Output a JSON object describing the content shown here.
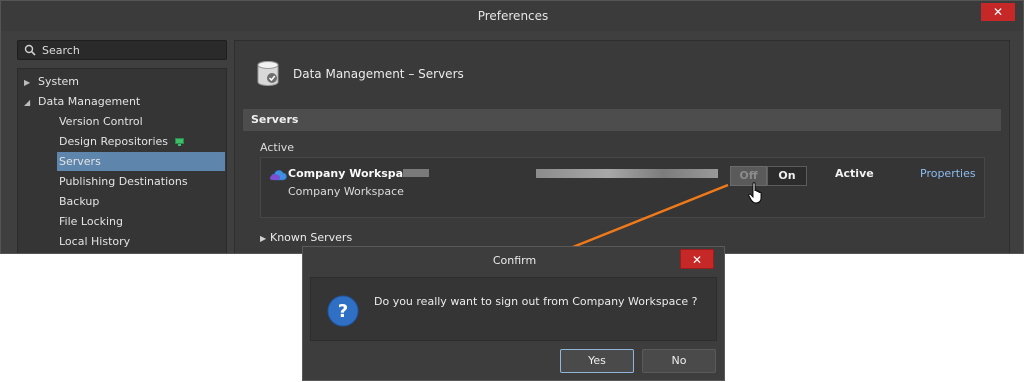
{
  "window": {
    "title": "Preferences",
    "close_glyph": "✕",
    "accent_close": "#c62828"
  },
  "search": {
    "placeholder": "Search",
    "icon": "search-icon"
  },
  "tree": {
    "items": [
      {
        "label": "System",
        "expand": "collapsed"
      },
      {
        "label": "Data Management",
        "expand": "expanded"
      },
      {
        "label": "Version Control"
      },
      {
        "label": "Design Repositories"
      },
      {
        "label": "Servers",
        "selected": true
      },
      {
        "label": "Publishing Destinations"
      },
      {
        "label": "Backup"
      },
      {
        "label": "File Locking"
      },
      {
        "label": "Local History"
      }
    ],
    "expanded_glyph": "◢",
    "collapsed_glyph": "▶",
    "selected_color": "#5e86ad"
  },
  "page": {
    "title": "Data Management – Servers",
    "section": "Servers",
    "active_label": "Active",
    "server": {
      "name": "Company Workspace",
      "subtitle": "Company Workspace",
      "toggle_off": "Off",
      "toggle_on": "On",
      "status": "Active",
      "properties_link": "Properties",
      "link_color": "#8cbcf0"
    },
    "known_servers": "Known Servers"
  },
  "annotation": {
    "arrow_color": "#f07a1a"
  },
  "dialog": {
    "title": "Confirm",
    "close_glyph": "✕",
    "message": "Do you really want to sign out from Company Workspace ?",
    "icon": "question-icon",
    "icon_color": "#2f6fc4",
    "icon_glyph": "?",
    "yes_label": "Yes",
    "no_label": "No"
  }
}
